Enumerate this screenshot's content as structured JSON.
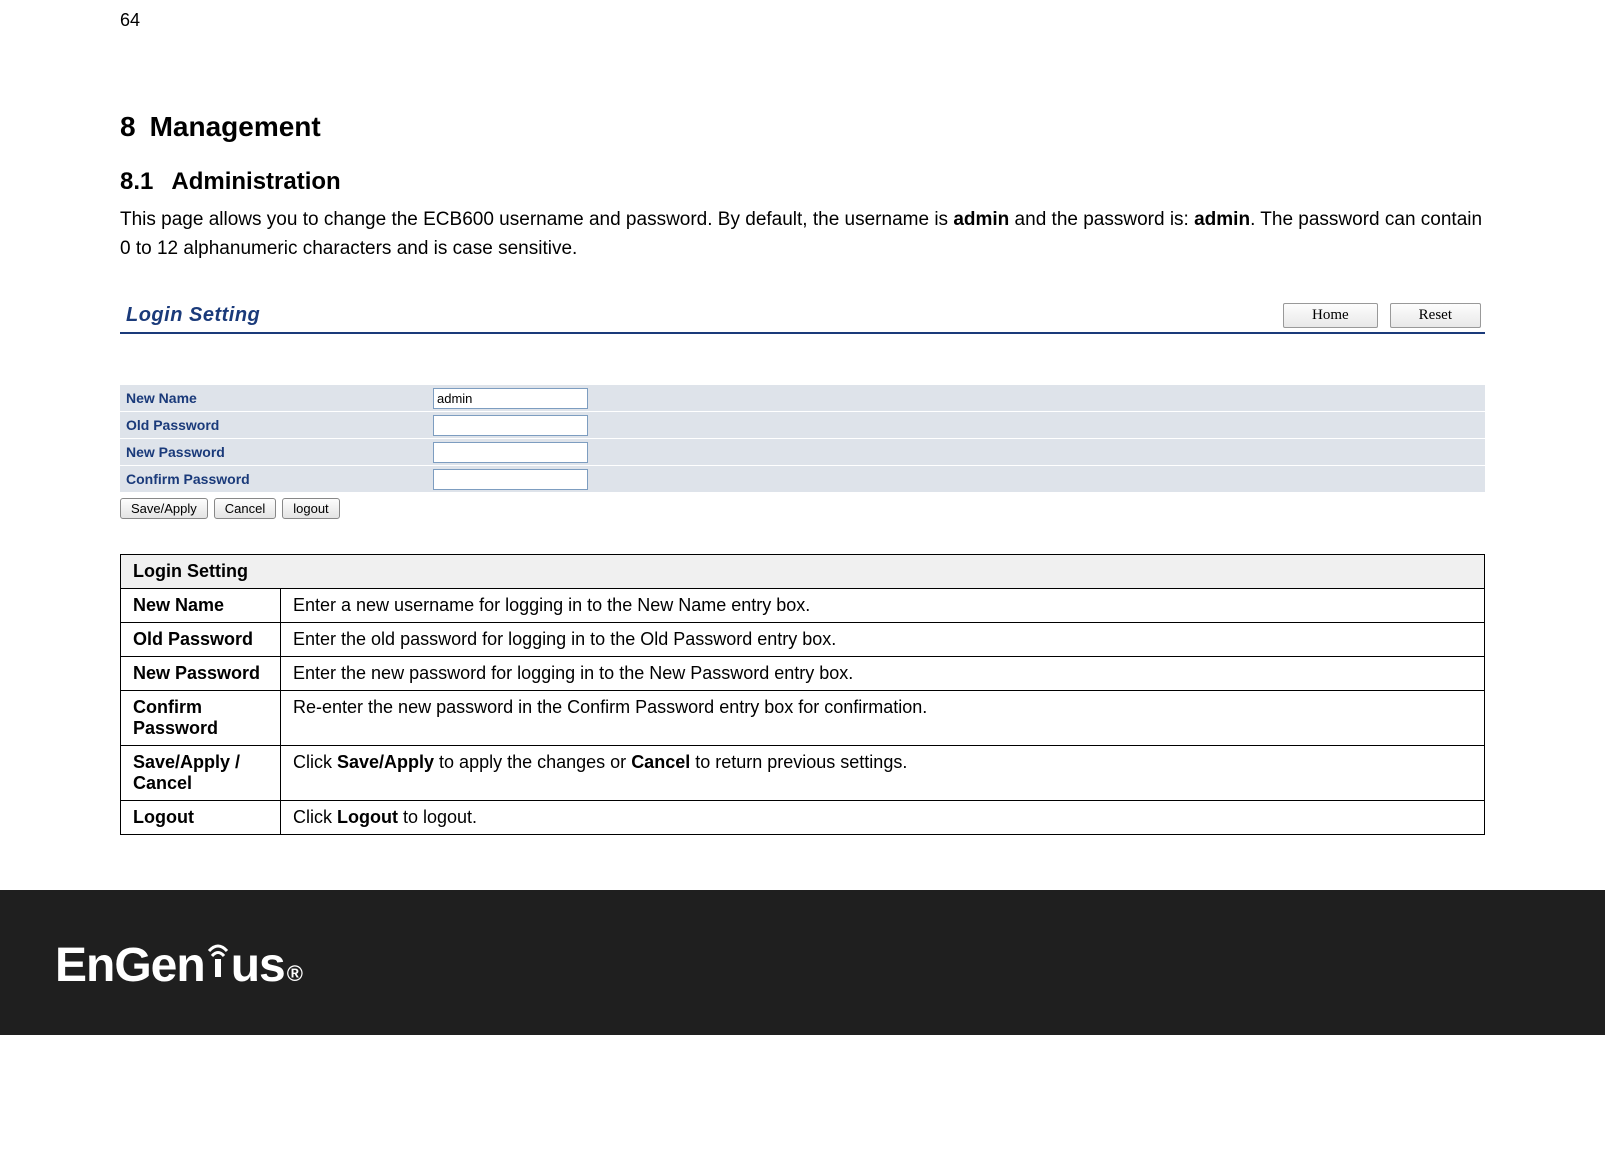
{
  "page_number": "64",
  "chapter": {
    "number": "8",
    "title": "Management"
  },
  "section": {
    "number": "8.1",
    "title": "Administration"
  },
  "intro": {
    "part1": "This page allows you to change the ECB600 username and password. By default, the username is ",
    "bold1": "admin",
    "part2": " and the password is: ",
    "bold2": "admin",
    "part3": ". The password can contain 0 to 12 alphanumeric characters and is case sensitive."
  },
  "ui_panel": {
    "title": "Login Setting",
    "nav": {
      "home": "Home",
      "reset": "Reset"
    },
    "rows": [
      {
        "label": "New Name",
        "value": "admin"
      },
      {
        "label": "Old Password",
        "value": ""
      },
      {
        "label": "New Password",
        "value": ""
      },
      {
        "label": "Confirm Password",
        "value": ""
      }
    ],
    "buttons": {
      "save": "Save/Apply",
      "cancel": "Cancel",
      "logout": "logout"
    }
  },
  "desc_table": {
    "header": "Login Setting",
    "rows": [
      {
        "name": "New Name",
        "desc_pre": "Enter a new username for logging in to the New Name entry box.",
        "b1": "",
        "mid": "",
        "b2": "",
        "post": ""
      },
      {
        "name": "Old Password",
        "desc_pre": "Enter the old password for logging in to the Old Password entry box.",
        "b1": "",
        "mid": "",
        "b2": "",
        "post": ""
      },
      {
        "name": "New Password",
        "desc_pre": "Enter the new password for logging in to the New Password entry box.",
        "b1": "",
        "mid": "",
        "b2": "",
        "post": ""
      },
      {
        "name": "Confirm Password",
        "desc_pre": "Re-enter the new password in the Confirm Password entry box for confirmation.",
        "b1": "",
        "mid": "",
        "b2": "",
        "post": ""
      },
      {
        "name": "Save/Apply / Cancel",
        "desc_pre": "Click ",
        "b1": "Save/Apply",
        "mid": " to apply the changes or ",
        "b2": "Cancel",
        "post": " to return previous settings."
      },
      {
        "name": "Logout",
        "desc_pre": "Click ",
        "b1": "Logout",
        "mid": " to logout.",
        "b2": "",
        "post": ""
      }
    ]
  },
  "footer": {
    "brand_pre": "EnGen",
    "brand_post": "us",
    "reg": "®"
  }
}
